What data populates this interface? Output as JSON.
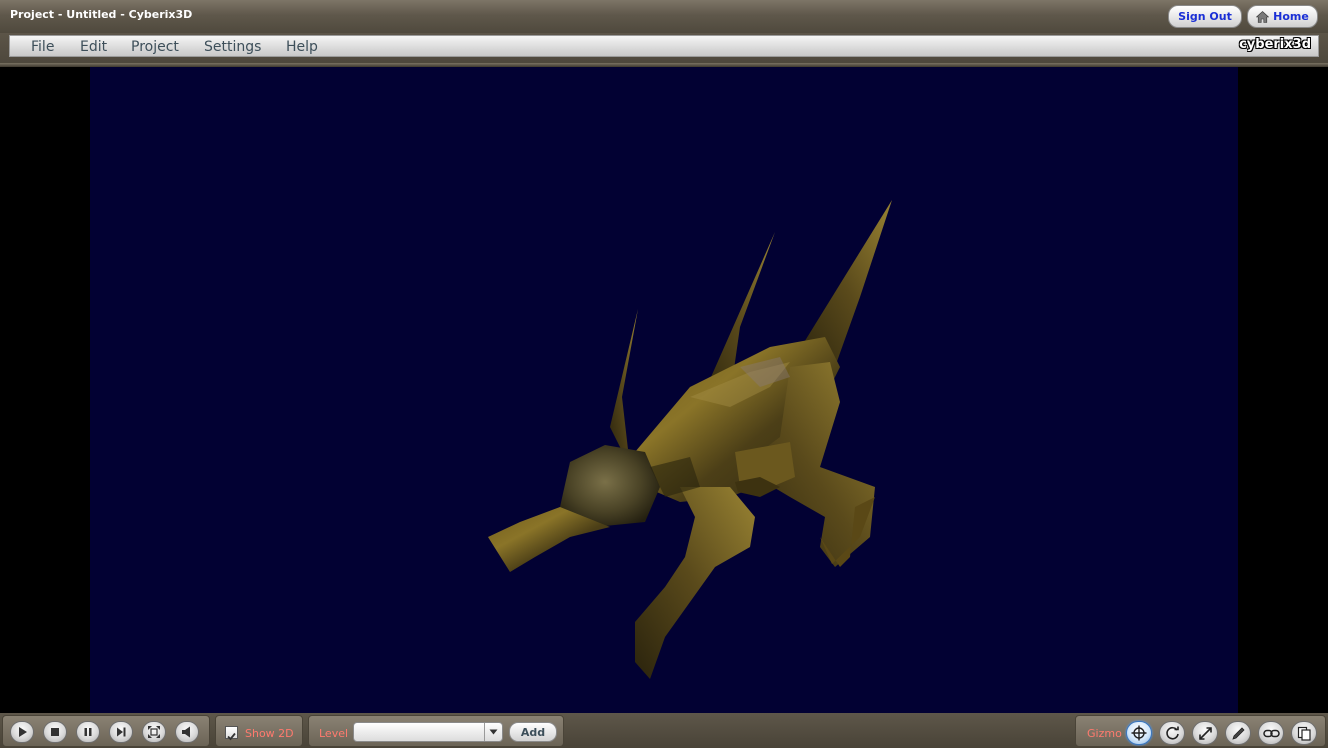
{
  "window": {
    "title": "Project - Untitled - Cyberix3D"
  },
  "header_buttons": {
    "sign_out": "Sign Out",
    "home": "Home"
  },
  "menu": {
    "items": [
      "File",
      "Edit",
      "Project",
      "Settings",
      "Help"
    ],
    "brand": "cyberix3d"
  },
  "viewport": {
    "background_color": "#020133",
    "side_color": "#000000",
    "object": "creature-model"
  },
  "playback": {
    "buttons": [
      "play-icon",
      "stop-icon",
      "pause-icon",
      "step-forward-icon",
      "fullscreen-icon",
      "sound-icon"
    ]
  },
  "display": {
    "show_2d_label": "Show 2D",
    "show_2d_checked": true
  },
  "level": {
    "label": "Level",
    "selected": "",
    "add_label": "Add"
  },
  "gizmo": {
    "label": "Gizmo",
    "tools": [
      "move-icon",
      "rotate-icon",
      "scale-icon",
      "edit-icon",
      "link-icon",
      "copy-icon"
    ],
    "active_tool": "move-icon"
  },
  "colors": {
    "accent_blue": "#1a2fd6",
    "label_red": "#ff7a6e",
    "toolbar_brown": "#5e574a"
  }
}
